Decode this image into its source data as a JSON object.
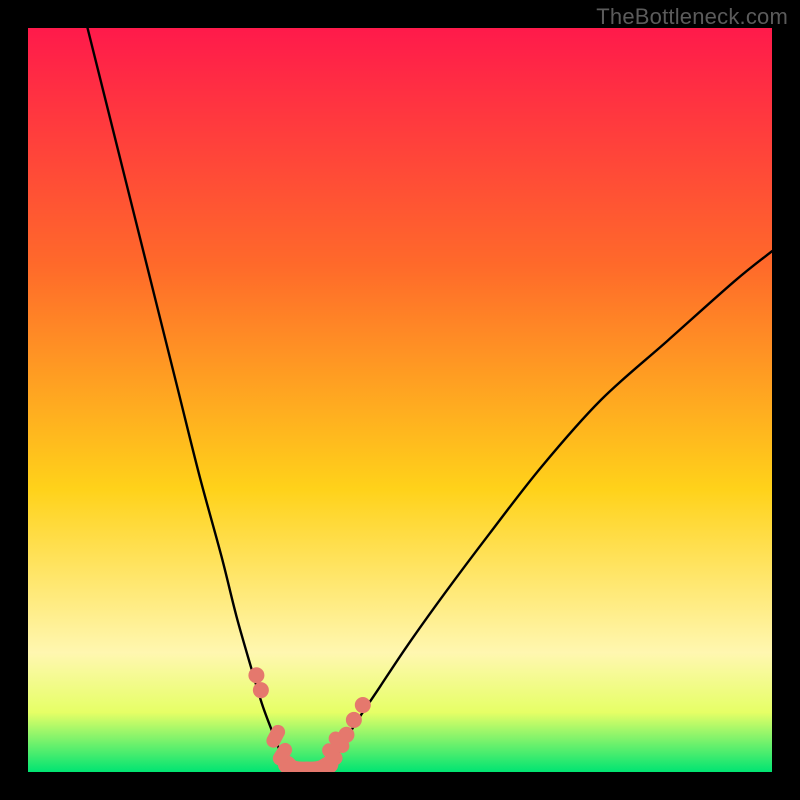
{
  "watermark": "TheBottleneck.com",
  "chart_data": {
    "type": "line",
    "title": "",
    "xlabel": "",
    "ylabel": "",
    "xlim": [
      0,
      100
    ],
    "ylim": [
      0,
      100
    ],
    "grid": false,
    "legend": false,
    "series": [
      {
        "name": "left-curve",
        "x": [
          8,
          12,
          16,
          20,
          23,
          26,
          28,
          30,
          31.5,
          33,
          34,
          34.8
        ],
        "y": [
          100,
          84,
          68,
          52,
          40,
          29,
          21,
          14,
          9,
          5,
          2.5,
          1
        ]
      },
      {
        "name": "right-curve",
        "x": [
          40.5,
          42,
          44,
          47,
          51,
          56,
          62,
          69,
          77,
          86,
          95,
          100
        ],
        "y": [
          1,
          3,
          6.5,
          11,
          17,
          24,
          32,
          41,
          50,
          58,
          66,
          70
        ]
      },
      {
        "name": "valley-band",
        "x": [
          34.8,
          35.5,
          36.5,
          37.5,
          38.5,
          39.5,
          40.5
        ],
        "y": [
          1,
          0.4,
          0.2,
          0.2,
          0.2,
          0.4,
          1
        ]
      }
    ],
    "markers": {
      "left": [
        {
          "x": 30.7,
          "y": 13.0
        },
        {
          "x": 31.3,
          "y": 11.0
        }
      ],
      "right": [
        {
          "x": 42.8,
          "y": 5.0
        },
        {
          "x": 43.8,
          "y": 7.0
        },
        {
          "x": 45.0,
          "y": 9.0
        }
      ],
      "oblong": [
        {
          "x": 33.3,
          "y": 4.8
        },
        {
          "x": 34.2,
          "y": 2.4
        },
        {
          "x": 40.9,
          "y": 2.4
        },
        {
          "x": 41.8,
          "y": 4.0
        }
      ]
    },
    "colors": {
      "gradient_top": "#ff1a4b",
      "gradient_mid1": "#ff6a2a",
      "gradient_mid2": "#ffd21a",
      "gradient_pale": "#fff7b0",
      "gradient_bottom": "#00e472",
      "curve": "#000000",
      "marker": "#e5786d",
      "frame": "#000000"
    }
  }
}
